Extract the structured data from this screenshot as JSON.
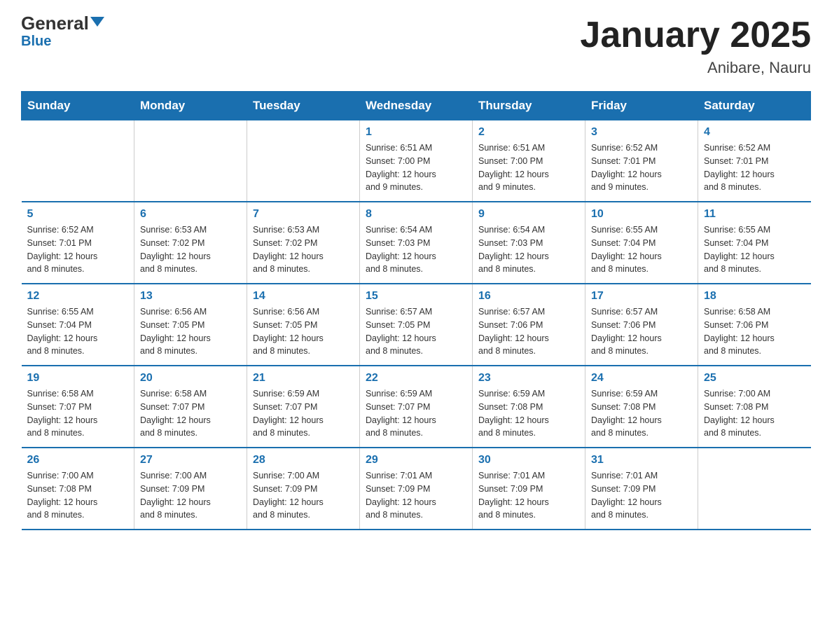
{
  "header": {
    "logo_general": "General",
    "logo_blue": "Blue",
    "main_title": "January 2025",
    "subtitle": "Anibare, Nauru"
  },
  "days_of_week": [
    "Sunday",
    "Monday",
    "Tuesday",
    "Wednesday",
    "Thursday",
    "Friday",
    "Saturday"
  ],
  "weeks": [
    [
      {
        "day": "",
        "info": ""
      },
      {
        "day": "",
        "info": ""
      },
      {
        "day": "",
        "info": ""
      },
      {
        "day": "1",
        "info": "Sunrise: 6:51 AM\nSunset: 7:00 PM\nDaylight: 12 hours\nand 9 minutes."
      },
      {
        "day": "2",
        "info": "Sunrise: 6:51 AM\nSunset: 7:00 PM\nDaylight: 12 hours\nand 9 minutes."
      },
      {
        "day": "3",
        "info": "Sunrise: 6:52 AM\nSunset: 7:01 PM\nDaylight: 12 hours\nand 9 minutes."
      },
      {
        "day": "4",
        "info": "Sunrise: 6:52 AM\nSunset: 7:01 PM\nDaylight: 12 hours\nand 8 minutes."
      }
    ],
    [
      {
        "day": "5",
        "info": "Sunrise: 6:52 AM\nSunset: 7:01 PM\nDaylight: 12 hours\nand 8 minutes."
      },
      {
        "day": "6",
        "info": "Sunrise: 6:53 AM\nSunset: 7:02 PM\nDaylight: 12 hours\nand 8 minutes."
      },
      {
        "day": "7",
        "info": "Sunrise: 6:53 AM\nSunset: 7:02 PM\nDaylight: 12 hours\nand 8 minutes."
      },
      {
        "day": "8",
        "info": "Sunrise: 6:54 AM\nSunset: 7:03 PM\nDaylight: 12 hours\nand 8 minutes."
      },
      {
        "day": "9",
        "info": "Sunrise: 6:54 AM\nSunset: 7:03 PM\nDaylight: 12 hours\nand 8 minutes."
      },
      {
        "day": "10",
        "info": "Sunrise: 6:55 AM\nSunset: 7:04 PM\nDaylight: 12 hours\nand 8 minutes."
      },
      {
        "day": "11",
        "info": "Sunrise: 6:55 AM\nSunset: 7:04 PM\nDaylight: 12 hours\nand 8 minutes."
      }
    ],
    [
      {
        "day": "12",
        "info": "Sunrise: 6:55 AM\nSunset: 7:04 PM\nDaylight: 12 hours\nand 8 minutes."
      },
      {
        "day": "13",
        "info": "Sunrise: 6:56 AM\nSunset: 7:05 PM\nDaylight: 12 hours\nand 8 minutes."
      },
      {
        "day": "14",
        "info": "Sunrise: 6:56 AM\nSunset: 7:05 PM\nDaylight: 12 hours\nand 8 minutes."
      },
      {
        "day": "15",
        "info": "Sunrise: 6:57 AM\nSunset: 7:05 PM\nDaylight: 12 hours\nand 8 minutes."
      },
      {
        "day": "16",
        "info": "Sunrise: 6:57 AM\nSunset: 7:06 PM\nDaylight: 12 hours\nand 8 minutes."
      },
      {
        "day": "17",
        "info": "Sunrise: 6:57 AM\nSunset: 7:06 PM\nDaylight: 12 hours\nand 8 minutes."
      },
      {
        "day": "18",
        "info": "Sunrise: 6:58 AM\nSunset: 7:06 PM\nDaylight: 12 hours\nand 8 minutes."
      }
    ],
    [
      {
        "day": "19",
        "info": "Sunrise: 6:58 AM\nSunset: 7:07 PM\nDaylight: 12 hours\nand 8 minutes."
      },
      {
        "day": "20",
        "info": "Sunrise: 6:58 AM\nSunset: 7:07 PM\nDaylight: 12 hours\nand 8 minutes."
      },
      {
        "day": "21",
        "info": "Sunrise: 6:59 AM\nSunset: 7:07 PM\nDaylight: 12 hours\nand 8 minutes."
      },
      {
        "day": "22",
        "info": "Sunrise: 6:59 AM\nSunset: 7:07 PM\nDaylight: 12 hours\nand 8 minutes."
      },
      {
        "day": "23",
        "info": "Sunrise: 6:59 AM\nSunset: 7:08 PM\nDaylight: 12 hours\nand 8 minutes."
      },
      {
        "day": "24",
        "info": "Sunrise: 6:59 AM\nSunset: 7:08 PM\nDaylight: 12 hours\nand 8 minutes."
      },
      {
        "day": "25",
        "info": "Sunrise: 7:00 AM\nSunset: 7:08 PM\nDaylight: 12 hours\nand 8 minutes."
      }
    ],
    [
      {
        "day": "26",
        "info": "Sunrise: 7:00 AM\nSunset: 7:08 PM\nDaylight: 12 hours\nand 8 minutes."
      },
      {
        "day": "27",
        "info": "Sunrise: 7:00 AM\nSunset: 7:09 PM\nDaylight: 12 hours\nand 8 minutes."
      },
      {
        "day": "28",
        "info": "Sunrise: 7:00 AM\nSunset: 7:09 PM\nDaylight: 12 hours\nand 8 minutes."
      },
      {
        "day": "29",
        "info": "Sunrise: 7:01 AM\nSunset: 7:09 PM\nDaylight: 12 hours\nand 8 minutes."
      },
      {
        "day": "30",
        "info": "Sunrise: 7:01 AM\nSunset: 7:09 PM\nDaylight: 12 hours\nand 8 minutes."
      },
      {
        "day": "31",
        "info": "Sunrise: 7:01 AM\nSunset: 7:09 PM\nDaylight: 12 hours\nand 8 minutes."
      },
      {
        "day": "",
        "info": ""
      }
    ]
  ]
}
